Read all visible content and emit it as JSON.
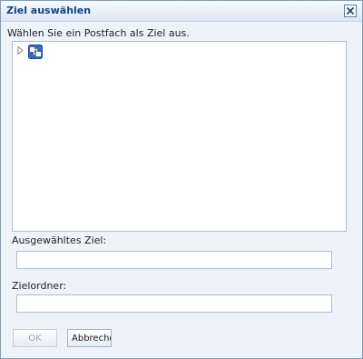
{
  "dialog": {
    "title": "Ziel auswählen",
    "instruction": "Wählen Sie ein Postfach als Ziel aus.",
    "tree": {
      "root": {
        "icon": "mailbox-tree-icon",
        "expanded": false
      }
    },
    "selected_target": {
      "label": "Ausgewähltes Ziel:",
      "value": ""
    },
    "target_folder": {
      "label": "Zielordner:",
      "value": ""
    },
    "buttons": {
      "ok": {
        "label": "OK",
        "enabled": false
      },
      "cancel": {
        "label": "Abbrechen"
      }
    }
  }
}
